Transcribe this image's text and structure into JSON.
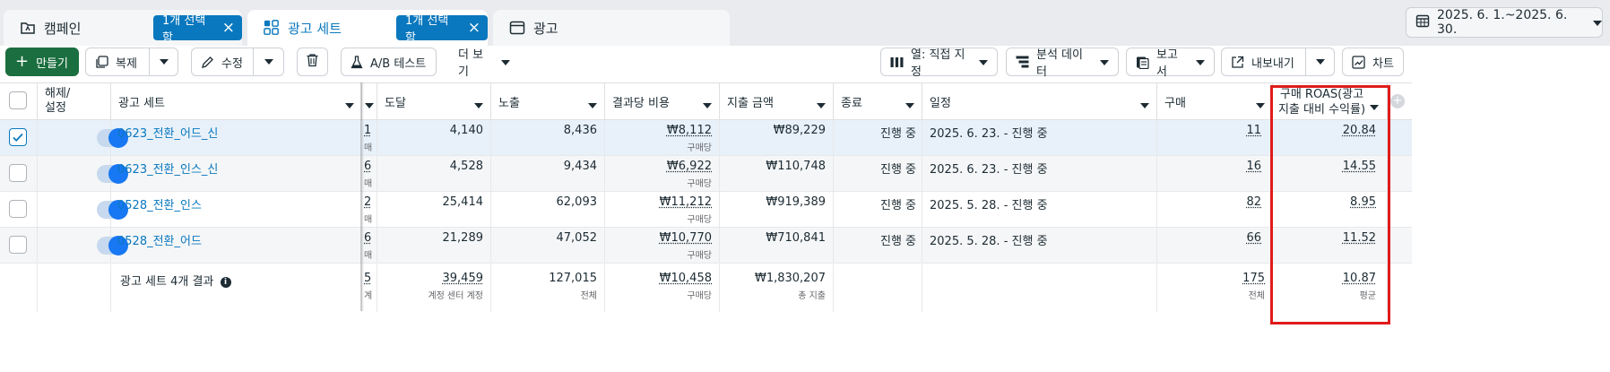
{
  "tabs": [
    {
      "label": "캠페인",
      "badge": "1개 선택함",
      "icon": "campaign-folder-icon"
    },
    {
      "label": "광고 세트",
      "badge": "1개 선택함",
      "icon": "grid-icon"
    },
    {
      "label": "광고",
      "icon": "ad-window-icon"
    }
  ],
  "date_range": "2025. 6. 1.~2025. 6. 30.",
  "toolbar": {
    "create": "만들기",
    "duplicate": "복제",
    "edit": "수정",
    "ab_test": "A/B 테스트",
    "more": "더 보기",
    "columns": "열: 직접 지정",
    "breakdown": "분석 데이터",
    "reports": "보고서",
    "export": "내보내기",
    "chart": "차트"
  },
  "headers": {
    "toggle": "해제/설정",
    "name": "광고 세트",
    "reach": "도달",
    "impressions": "노출",
    "cpr": "결과당 비용",
    "spend": "지출 금액",
    "end": "종료",
    "schedule": "일정",
    "purchases": "구매",
    "roas_line1": "구매 ROAS(광고",
    "roas_line2": "지출 대비 수익률)"
  },
  "rows": [
    {
      "name": "0623_전환_어드_신",
      "clip": "1",
      "reach": "4,140",
      "impressions": "8,436",
      "cpr": "₩8,112",
      "cpr_sub": "구매당",
      "spend": "₩89,229",
      "end": "진행 중",
      "schedule": "2025. 6. 23. - 진행 중",
      "purchases": "11",
      "roas": "20.84"
    },
    {
      "name": "0623_전환_인스_신",
      "clip": "6",
      "reach": "4,528",
      "impressions": "9,434",
      "cpr": "₩6,922",
      "cpr_sub": "구매당",
      "spend": "₩110,748",
      "end": "진행 중",
      "schedule": "2025. 6. 23. - 진행 중",
      "purchases": "16",
      "roas": "14.55"
    },
    {
      "name": "0528_전환_인스",
      "clip": "2",
      "reach": "25,414",
      "impressions": "62,093",
      "cpr": "₩11,212",
      "cpr_sub": "구매당",
      "spend": "₩919,389",
      "end": "진행 중",
      "schedule": "2025. 5. 28. - 진행 중",
      "purchases": "82",
      "roas": "8.95"
    },
    {
      "name": "0528_전환_어드",
      "clip": "6",
      "reach": "21,289",
      "impressions": "47,052",
      "cpr": "₩10,770",
      "cpr_sub": "구매당",
      "spend": "₩710,841",
      "end": "진행 중",
      "schedule": "2025. 5. 28. - 진행 중",
      "purchases": "66",
      "roas": "11.52"
    }
  ],
  "totals": {
    "label": "광고 세트 4개 결과",
    "clip": "5",
    "reach": "39,459",
    "reach_sub": "계정 센터 계정",
    "impressions": "127,015",
    "impressions_sub": "전체",
    "cpr": "₩10,458",
    "cpr_sub": "구매당",
    "spend": "₩1,830,207",
    "spend_sub": "총 지출",
    "purchases": "175",
    "purchases_sub": "전체",
    "roas": "10.87",
    "roas_sub": "평균"
  },
  "colors": {
    "accent": "#0a78be",
    "primary_green": "#1b6e3f",
    "highlight": "#e01b1b"
  }
}
